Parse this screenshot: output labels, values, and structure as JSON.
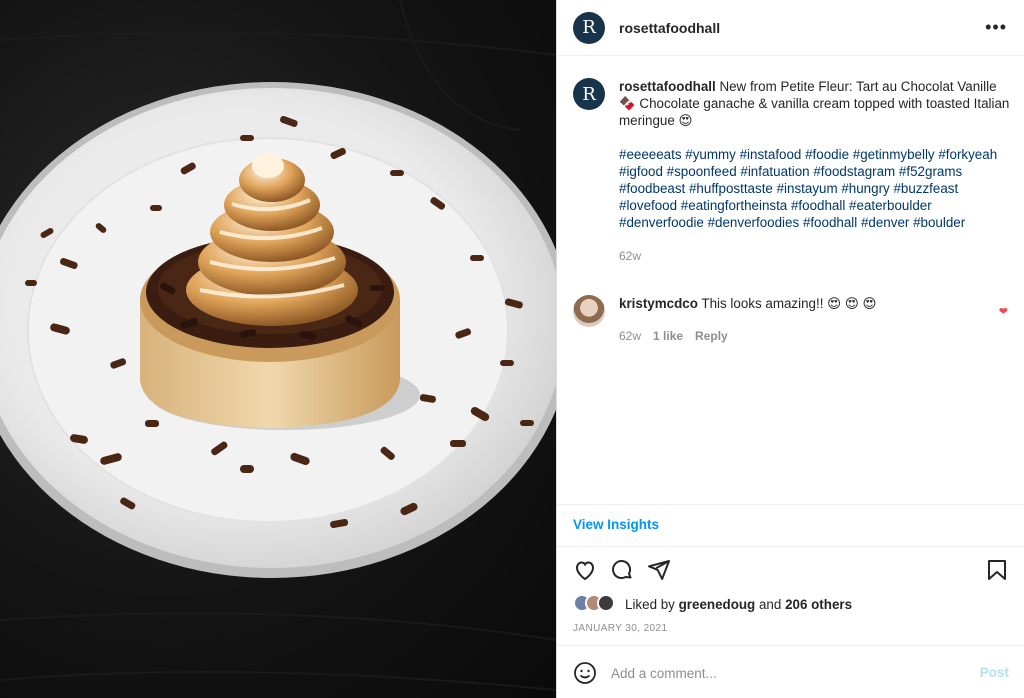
{
  "post": {
    "username": "rosettafoodhall",
    "avatar_letter": "R",
    "more_label": "•••",
    "caption": {
      "username": "rosettafoodhall",
      "text": " New from Petite Fleur: Tart au Chocolat Vanille 🍫 Chocolate ganache & vanilla cream topped with toasted Italian meringue 😍",
      "hashtags": "#eeeeeats #yummy #instafood #foodie #getinmybelly #forkyeah #igfood #spoonfeed #infatuation #foodstagram #f52grams #foodbeast #huffposttaste #instayum #hungry #buzzfeast #lovefood #eatingfortheinsta #foodhall #eaterboulder #denverfoodie #denverfoodies #foodhall #denver #boulder",
      "time": "62w"
    },
    "comment": {
      "username": "kristymcdco",
      "text": " This looks amazing!! 😍 😍 😍",
      "time": "62w",
      "likes": "1 like",
      "reply": "Reply"
    },
    "view_insights": "View Insights",
    "liked_by": {
      "prefix": "Liked by ",
      "user": "greenedoug",
      "middle": " and ",
      "others": "206 others"
    },
    "date": "JANUARY 30, 2021",
    "add_comment_placeholder": "Add a comment...",
    "post_button": "Post",
    "icons": {
      "like": "heart-icon",
      "comment": "comment-bubble-icon",
      "share": "paper-plane-icon",
      "save": "bookmark-icon",
      "emoji": "emoji-smiley-icon",
      "comment_like": "small-heart-icon"
    },
    "colors": {
      "brand_avatar": "#18344a",
      "hashtag": "#00376b",
      "link_blue": "#0095f6",
      "post_disabled": "#b2dffc",
      "heart_red": "#ed4956"
    }
  }
}
